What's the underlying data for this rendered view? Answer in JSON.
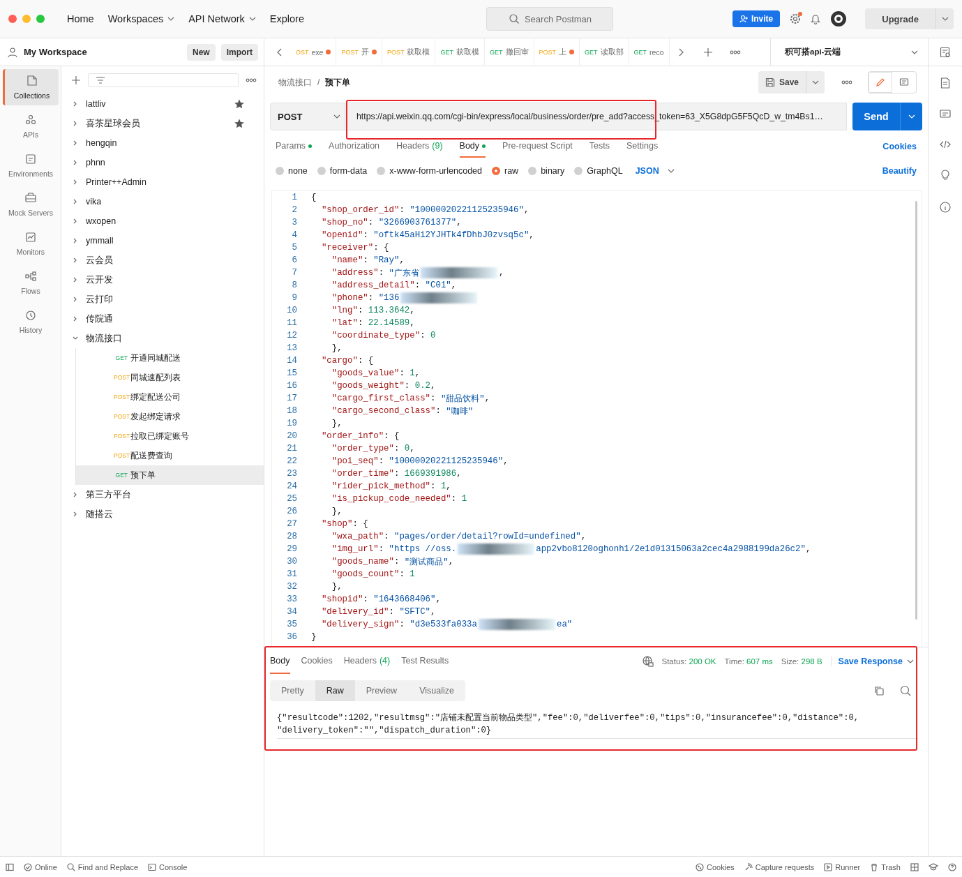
{
  "topbar": {
    "nav": [
      {
        "label": "Home",
        "dropdown": false
      },
      {
        "label": "Workspaces",
        "dropdown": true
      },
      {
        "label": "API Network",
        "dropdown": true
      },
      {
        "label": "Explore",
        "dropdown": false
      }
    ],
    "search": {
      "placeholder": "Search Postman"
    },
    "invite": "Invite",
    "notification_dot": true,
    "upgrade": "Upgrade"
  },
  "workspace": {
    "name": "My Workspace",
    "buttons": [
      "New",
      "Import"
    ]
  },
  "rail": [
    {
      "label": "Collections",
      "kind": "collections",
      "selected": true
    },
    {
      "label": "APIs",
      "kind": "apis",
      "selected": false
    },
    {
      "label": "Environments",
      "kind": "environments",
      "selected": false
    },
    {
      "label": "Mock Servers",
      "kind": "mock",
      "selected": false
    },
    {
      "label": "Monitors",
      "kind": "monitors",
      "selected": false
    },
    {
      "label": "Flows",
      "kind": "flows",
      "selected": false
    },
    {
      "label": "History",
      "kind": "history",
      "selected": false
    }
  ],
  "collections": [
    {
      "name": "lattliv",
      "starred": true,
      "expanded": false
    },
    {
      "name": "喜茶星球会员",
      "starred": true,
      "expanded": false
    },
    {
      "name": "hengqin",
      "starred": false,
      "expanded": false
    },
    {
      "name": "phnn",
      "starred": false,
      "expanded": false
    },
    {
      "name": "Printer++Admin",
      "starred": false,
      "expanded": false
    },
    {
      "name": "vika",
      "starred": false,
      "expanded": false
    },
    {
      "name": "wxopen",
      "starred": false,
      "expanded": false
    },
    {
      "name": "ymmall",
      "starred": false,
      "expanded": false
    },
    {
      "name": "云会员",
      "starred": false,
      "expanded": false
    },
    {
      "name": "云开发",
      "starred": false,
      "expanded": false
    },
    {
      "name": "云打印",
      "starred": false,
      "expanded": false
    },
    {
      "name": "传院通",
      "starred": false,
      "expanded": false
    },
    {
      "name": "物流接口",
      "starred": false,
      "expanded": true,
      "children": [
        {
          "kind": "get",
          "method": "GET",
          "name": "开通同城配送",
          "selected": false
        },
        {
          "kind": "post",
          "method": "POST",
          "name": "同城速配列表",
          "selected": false
        },
        {
          "kind": "post",
          "method": "POST",
          "name": "绑定配送公司",
          "selected": false
        },
        {
          "kind": "post",
          "method": "POST",
          "name": "发起绑定请求",
          "selected": false
        },
        {
          "kind": "post",
          "method": "POST",
          "name": "拉取已绑定账号",
          "selected": false
        },
        {
          "kind": "post",
          "method": "POST",
          "name": "配送费查询",
          "selected": false
        },
        {
          "kind": "get",
          "method": "GET",
          "name": "预下单",
          "selected": true
        }
      ]
    },
    {
      "name": "第三方平台",
      "starred": false,
      "expanded": false
    },
    {
      "name": "随搭云",
      "starred": false,
      "expanded": false
    }
  ],
  "tabs": [
    {
      "kind": "post",
      "method": "OST",
      "label": "exe",
      "unsaved": true
    },
    {
      "kind": "post",
      "method": "POST",
      "label": "开",
      "unsaved": true
    },
    {
      "kind": "post",
      "method": "POST",
      "label": "获取模",
      "unsaved": false
    },
    {
      "kind": "get",
      "method": "GET",
      "label": "获取模",
      "unsaved": false
    },
    {
      "kind": "get",
      "method": "GET",
      "label": "撤回审",
      "unsaved": false
    },
    {
      "kind": "post",
      "method": "POST",
      "label": "上",
      "unsaved": true
    },
    {
      "kind": "get",
      "method": "GET",
      "label": "读取部",
      "unsaved": false
    },
    {
      "kind": "get",
      "method": "GET",
      "label": "reco",
      "unsaved": false
    }
  ],
  "environment": "积可搭api-云端",
  "request": {
    "breadcrumb": [
      "物流接口",
      "预下单"
    ],
    "breadcrumb_separator": "/",
    "save": "Save",
    "method": "POST",
    "url": "https://api.weixin.qq.com/cgi-bin/express/local/business/order/pre_add?access_token=63_X5G8dpG5F5QcD_w_tm4Bs1…",
    "send": "Send",
    "tabs": [
      {
        "label": "Params",
        "dot": true,
        "selected": false
      },
      {
        "label": "Authorization",
        "dot": false,
        "selected": false
      },
      {
        "label": "Headers",
        "count": "(9)",
        "dot": false,
        "selected": false
      },
      {
        "label": "Body",
        "dot": true,
        "selected": true
      },
      {
        "label": "Pre-request Script",
        "dot": false,
        "selected": false
      },
      {
        "label": "Tests",
        "dot": false,
        "selected": false
      },
      {
        "label": "Settings",
        "dot": false,
        "selected": false
      }
    ],
    "cookies": "Cookies",
    "body_types": [
      {
        "label": "none",
        "selected": false
      },
      {
        "label": "form-data",
        "selected": false
      },
      {
        "label": "x-www-form-urlencoded",
        "selected": false
      },
      {
        "label": "raw",
        "selected": true
      },
      {
        "label": "binary",
        "selected": false
      },
      {
        "label": "GraphQL",
        "selected": false
      }
    ],
    "language": "JSON",
    "beautify": "Beautify",
    "code": [
      {
        "n": "1",
        "text": "{"
      },
      {
        "n": "2",
        "text": "  \"shop_order_id\": \"10000020221125235946\","
      },
      {
        "n": "3",
        "text": "  \"shop_no\": \"3266903761377\","
      },
      {
        "n": "4",
        "text": "  \"openid\": \"oftk45aHi2YJHTk4fDhbJ0zvsq5c\","
      },
      {
        "n": "5",
        "text": "  \"receiver\": {"
      },
      {
        "n": "6",
        "text": "    \"name\": \"Ray\","
      },
      {
        "n": "7",
        "text": "    \"address\": \"广东省",
        "redacted": true,
        "tail": ","
      },
      {
        "n": "8",
        "text": "    \"address_detail\": \"C01\","
      },
      {
        "n": "9",
        "text": "    \"phone\": \"136",
        "redacted": true
      },
      {
        "n": "10",
        "text": "    \"lng\": 113.3642,"
      },
      {
        "n": "11",
        "text": "    \"lat\": 22.14589,"
      },
      {
        "n": "12",
        "text": "    \"coordinate_type\": 0"
      },
      {
        "n": "13",
        "text": "    },"
      },
      {
        "n": "14",
        "text": "  \"cargo\": {"
      },
      {
        "n": "15",
        "text": "    \"goods_value\": 1,"
      },
      {
        "n": "16",
        "text": "    \"goods_weight\": 0.2,"
      },
      {
        "n": "17",
        "text": "    \"cargo_first_class\": \"甜品饮料\","
      },
      {
        "n": "18",
        "text": "    \"cargo_second_class\": \"咖啡\""
      },
      {
        "n": "19",
        "text": "    },"
      },
      {
        "n": "20",
        "text": "  \"order_info\": {"
      },
      {
        "n": "21",
        "text": "    \"order_type\": 0,"
      },
      {
        "n": "22",
        "text": "    \"poi_seq\": \"10000020221125235946\","
      },
      {
        "n": "23",
        "text": "    \"order_time\": 1669391986,"
      },
      {
        "n": "24",
        "text": "    \"rider_pick_method\": 1,"
      },
      {
        "n": "25",
        "text": "    \"is_pickup_code_needed\": 1"
      },
      {
        "n": "26",
        "text": "    },"
      },
      {
        "n": "27",
        "text": "  \"shop\": {"
      },
      {
        "n": "28",
        "text": "    \"wxa_path\": \"pages/order/detail?rowId=undefined\","
      },
      {
        "n": "29",
        "text": "    \"img_url\": \"https //oss.",
        "redacted": true,
        "tail": "app2vbo8120oghonh1/2e1d01315063a2cec4a2988199da26c2\","
      },
      {
        "n": "30",
        "text": "    \"goods_name\": \"测试商品\","
      },
      {
        "n": "31",
        "text": "    \"goods_count\": 1"
      },
      {
        "n": "32",
        "text": "    },"
      },
      {
        "n": "33",
        "text": "  \"shopid\": \"1643668406\","
      },
      {
        "n": "34",
        "text": "  \"delivery_id\": \"SFTC\","
      },
      {
        "n": "35",
        "text": "  \"delivery_sign\": \"d3e533fa033a",
        "redacted": true,
        "tail": "ea\""
      },
      {
        "n": "36",
        "text": "}"
      }
    ]
  },
  "response": {
    "tabs": [
      {
        "label": "Body",
        "selected": true
      },
      {
        "label": "Cookies",
        "selected": false
      },
      {
        "label": "Headers",
        "count": "(4)",
        "selected": false
      },
      {
        "label": "Test Results",
        "selected": false
      }
    ],
    "stats": [
      {
        "label": "Status:",
        "value": "200 OK"
      },
      {
        "label": "Time:",
        "value": "607 ms"
      },
      {
        "label": "Size:",
        "value": "298 B"
      }
    ],
    "save": "Save Response",
    "views": [
      {
        "label": "Pretty",
        "selected": false
      },
      {
        "label": "Raw",
        "selected": true
      },
      {
        "label": "Preview",
        "selected": false
      },
      {
        "label": "Visualize",
        "selected": false
      }
    ],
    "lines": [
      "{\"resultcode\":1202,\"resultmsg\":\"店铺未配置当前物品类型\",\"fee\":0,\"deliverfee\":0,\"tips\":0,\"insurancefee\":0,\"distance\":0,",
      "\"delivery_token\":\"\",\"dispatch_duration\":0}"
    ]
  },
  "statusbar": {
    "left": [
      {
        "kind": "online",
        "label": "Online"
      },
      {
        "kind": "find",
        "label": "Find and Replace"
      },
      {
        "kind": "console",
        "label": "Console"
      }
    ],
    "right": [
      {
        "kind": "cookies",
        "label": "Cookies"
      },
      {
        "kind": "capture",
        "label": "Capture requests"
      },
      {
        "kind": "runner",
        "label": "Runner"
      },
      {
        "kind": "trash",
        "label": "Trash"
      }
    ]
  }
}
